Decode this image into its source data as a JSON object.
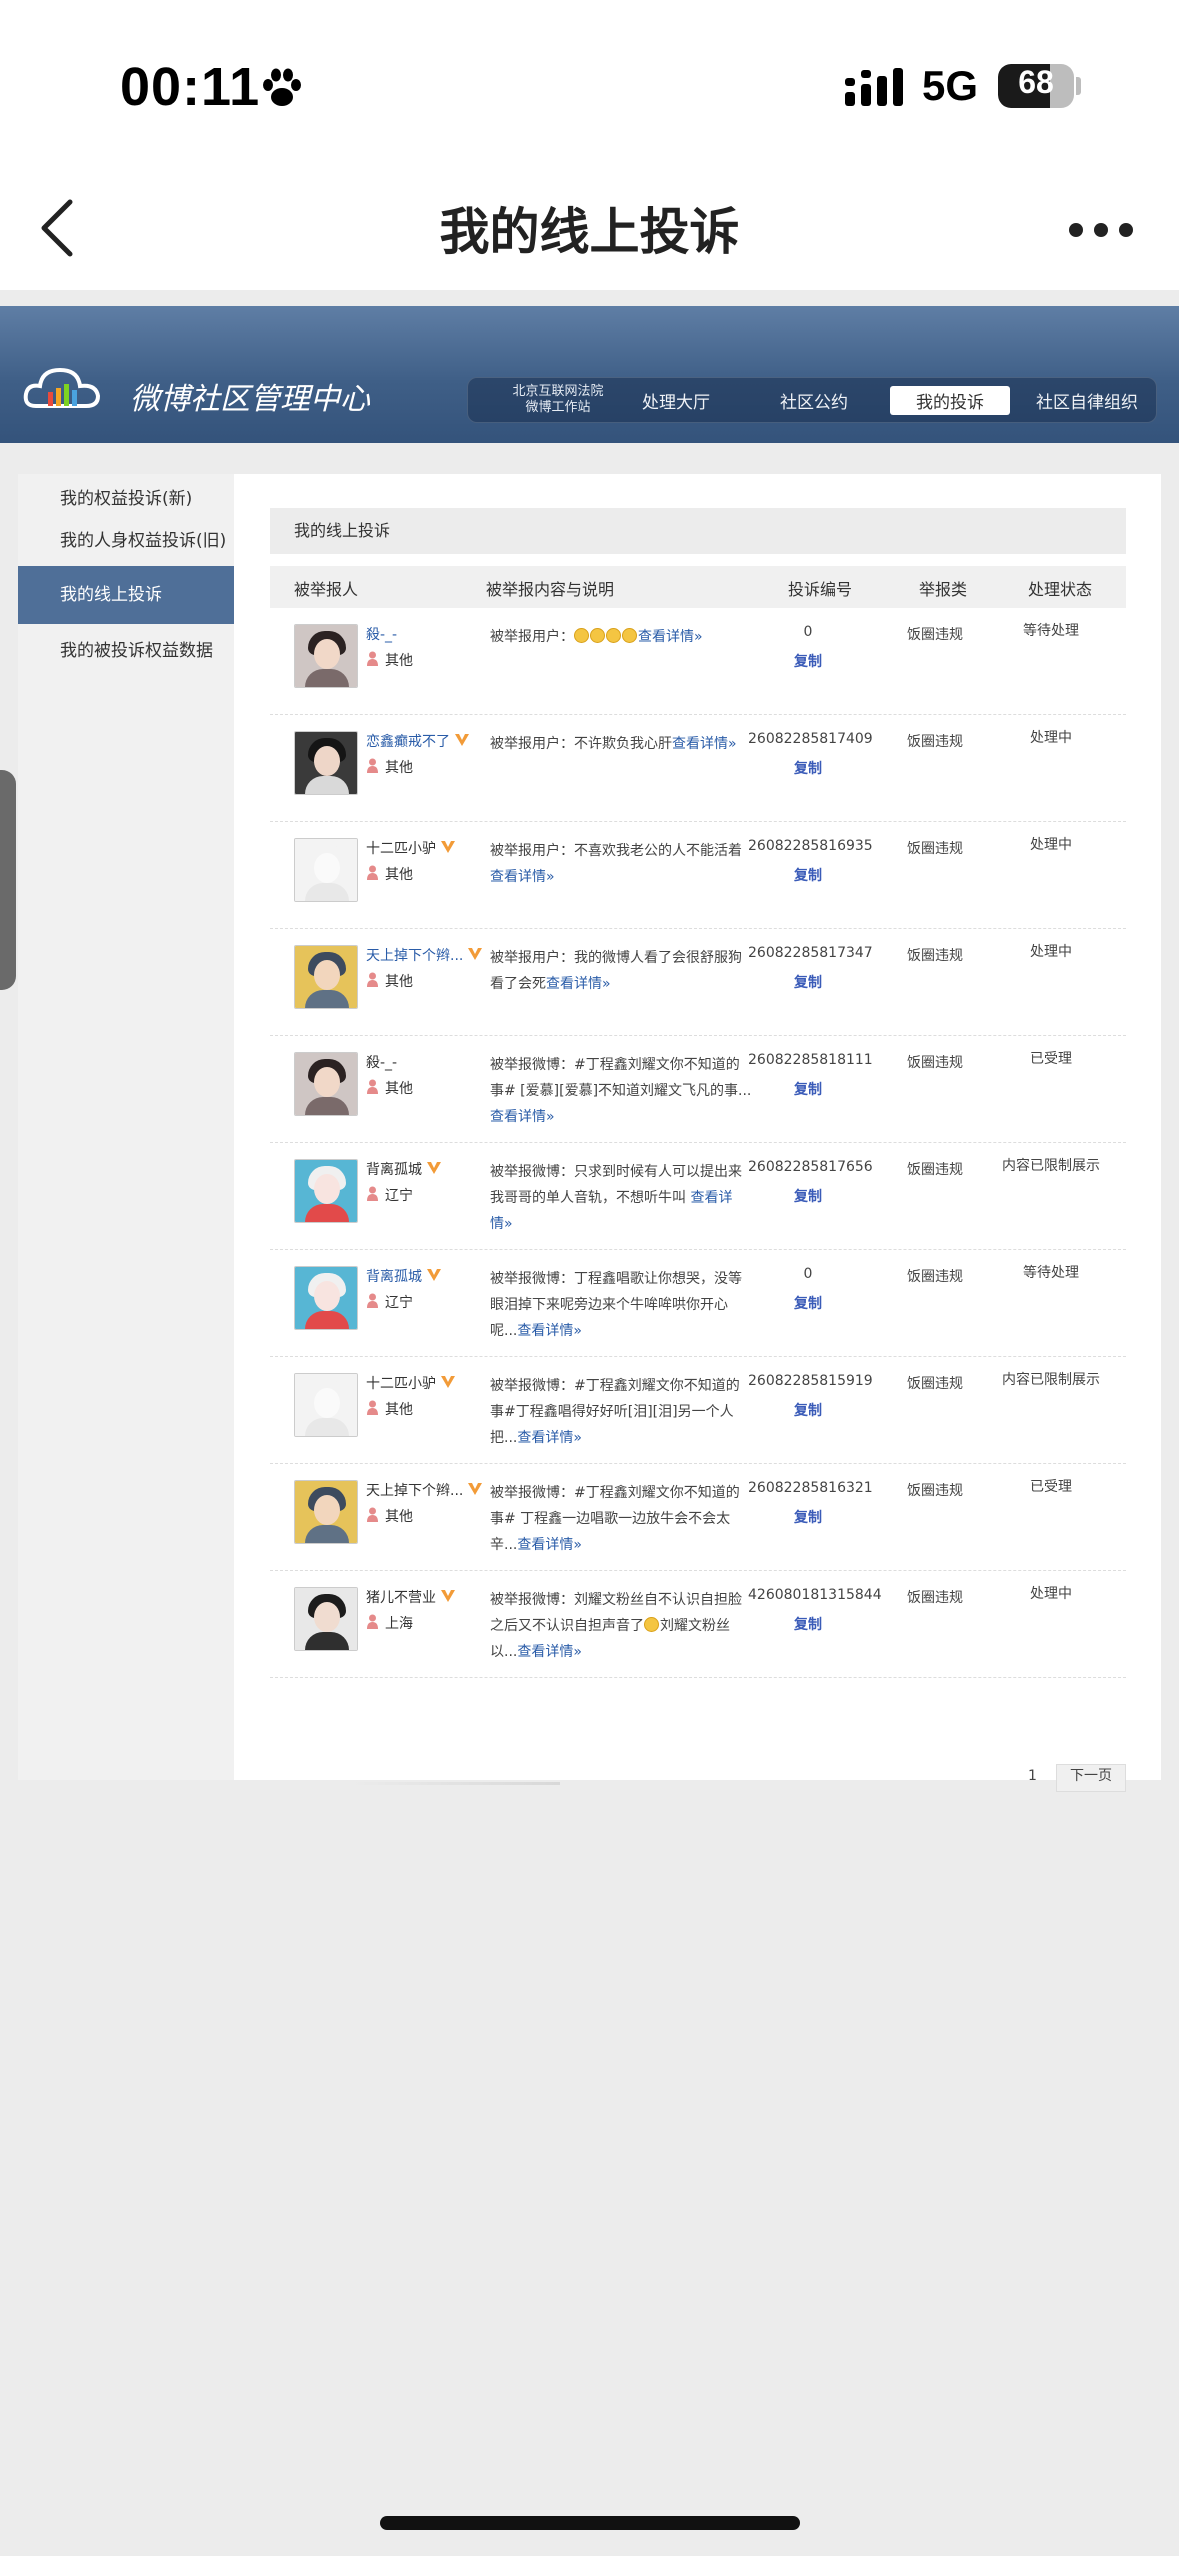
{
  "status_bar": {
    "time": "00:11",
    "network": "5G",
    "battery": "68",
    "battery_level": 0.68
  },
  "nav": {
    "title": "我的线上投诉",
    "back_icon": "chevron-left-icon",
    "more_icon": "more-dots-icon"
  },
  "weibo_header": {
    "title": "微博社区管理中心",
    "court_line1": "北京互联网法院",
    "court_line2": "微博工作站",
    "items": [
      "处理大厅",
      "社区公约",
      "我的投诉",
      "社区自律组织"
    ],
    "active": "我的投诉"
  },
  "sidebar": {
    "items": [
      "我的权益投诉(新)",
      "我的人身权益投诉(旧)",
      "我的线上投诉",
      "我的被投诉权益数据"
    ]
  },
  "table": {
    "box_title": "我的线上投诉",
    "headers": [
      "被举报人",
      "被举报内容与说明",
      "投诉编号",
      "举报类",
      "处理状态"
    ],
    "copy_label": "复制",
    "rows": [
      {
        "name": "殺-_-",
        "blue": true,
        "verified": false,
        "location": "其他",
        "desc_text": "被举报用户：",
        "emoji_count": 4,
        "desc_link": "查看详情»",
        "id": "0",
        "type": "饭圈违规",
        "status": "等待处理",
        "avatar": "girl-dark"
      },
      {
        "name": "恋鑫癫戒不了",
        "blue": true,
        "verified": true,
        "location": "其他",
        "desc_text": "被举报用户：不许欺负我心肝",
        "emoji_count": 0,
        "desc_link": "查看详情»",
        "id": "26082285817409",
        "type": "饭圈违规",
        "status": "处理中",
        "avatar": "girl-dark2"
      },
      {
        "name": "十二匹小驴",
        "blue": false,
        "verified": true,
        "location": "其他",
        "desc_text": "被举报用户：不喜欢我老公的人不能活着",
        "emoji_count": 0,
        "desc_link": "查看详情»",
        "id": "26082285816935",
        "type": "饭圈违规",
        "status": "处理中",
        "avatar": "forky"
      },
      {
        "name": "天上掉下个辫...",
        "blue": true,
        "verified": true,
        "location": "其他",
        "desc_text": "被举报用户：我的微博人看了会很舒服狗看了会死",
        "emoji_count": 0,
        "desc_link": "查看详情»",
        "id": "26082285817347",
        "type": "饭圈违规",
        "status": "处理中",
        "avatar": "boy-cap"
      },
      {
        "name": "殺-_-",
        "blue": false,
        "verified": false,
        "location": "其他",
        "desc_text": "被举报微博：#丁程鑫刘耀文你不知道的事# [爱慕][爱慕]不知道刘耀文飞凡的事...",
        "emoji_count": 0,
        "desc_link": "查看详情»",
        "id": "26082285818111",
        "type": "饭圈违规",
        "status": "已受理",
        "avatar": "girl-dark"
      },
      {
        "name": "背离孤城",
        "blue": false,
        "verified": true,
        "location": "辽宁",
        "desc_text": "被举报微博：只求到时候有人可以提出来我哥哥的单人音轨，不想听牛叫 ",
        "emoji_count": 0,
        "desc_link": "查看详情»",
        "id": "26082285817656",
        "type": "饭圈违规",
        "status": "内容已限制展示",
        "avatar": "clown"
      },
      {
        "name": "背离孤城",
        "blue": true,
        "verified": true,
        "location": "辽宁",
        "desc_text": "被举报微博：丁程鑫唱歌让你想哭，没等眼泪掉下来呢旁边来个牛哞哞哄你开心呢...",
        "emoji_count": 0,
        "desc_link": "查看详情»",
        "id": "0",
        "type": "饭圈违规",
        "status": "等待处理",
        "avatar": "clown"
      },
      {
        "name": "十二匹小驴",
        "blue": false,
        "verified": true,
        "location": "其他",
        "desc_text": "被举报微博：#丁程鑫刘耀文你不知道的事#丁程鑫唱得好好听[泪][泪]另一个人把...",
        "emoji_count": 0,
        "desc_link": "查看详情»",
        "id": "26082285815919",
        "type": "饭圈违规",
        "status": "内容已限制展示",
        "avatar": "forky"
      },
      {
        "name": "天上掉下个辫...",
        "blue": false,
        "verified": true,
        "location": "其他",
        "desc_text": "被举报微博：#丁程鑫刘耀文你不知道的事# 丁程鑫一边唱歌一边放牛会不会太辛...",
        "emoji_count": 0,
        "desc_link": "查看详情»",
        "id": "26082285816321",
        "type": "饭圈违规",
        "status": "已受理",
        "avatar": "boy-cap"
      },
      {
        "name": "猪儿不营业",
        "blue": false,
        "verified": true,
        "location": "上海",
        "desc_text": "被举报微博：刘耀文粉丝自不认识自担脸之后又不认识自担声音了",
        "desc_tail": "刘耀文粉丝以...",
        "emoji_count": 1,
        "desc_link": "查看详情»",
        "id": "426080181315844",
        "type": "饭圈违规",
        "status": "处理中",
        "avatar": "boy-dark"
      }
    ]
  },
  "pager": {
    "page": "1",
    "next_label": "下一页"
  },
  "colors": {
    "header_blue": "#3f5f87",
    "sidebar_active": "#4f6f98",
    "link_blue": "#2a5ca8",
    "copy_blue": "#3a5bb8",
    "verified_orange": "#f29b38"
  }
}
